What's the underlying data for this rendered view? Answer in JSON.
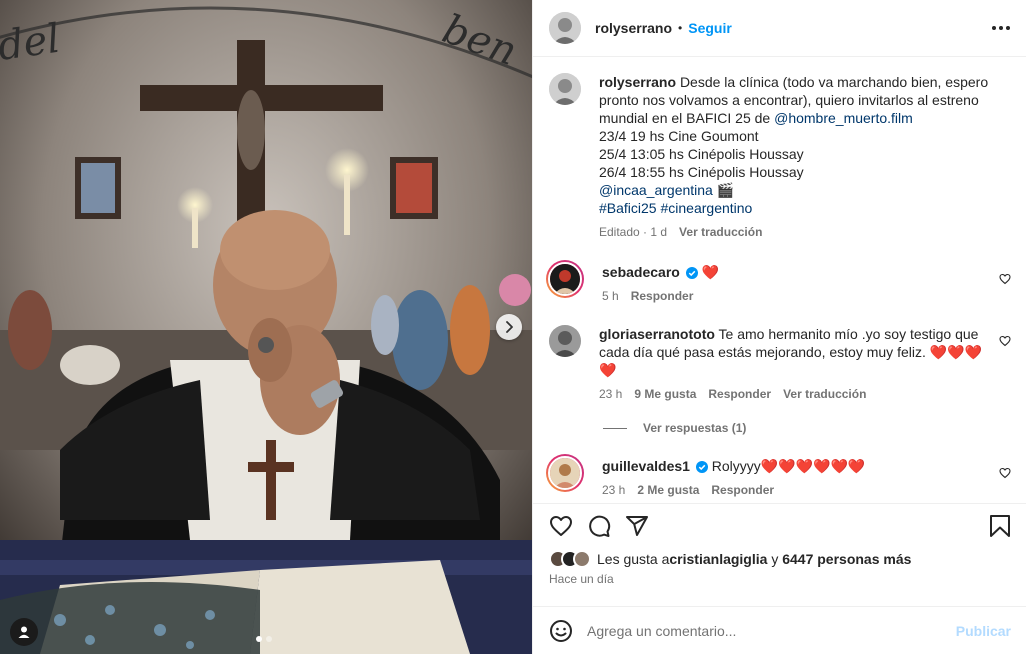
{
  "post": {
    "username": "rolyserrano",
    "follow_label": "Seguir",
    "separator": "•"
  },
  "caption": {
    "username": "rolyserrano",
    "line1": "Desde la clínica (todo va marchando bien, espero pronto nos volvamos a encontrar), quiero invitarlos al estreno mundial en el BAFICI 25 de ",
    "mention1": "@hombre_muerto.film",
    "line2": "23/4 19 hs Cine Goumont",
    "line3": "25/4 13:05 hs Cinépolis Houssay",
    "line4": "26/4 18:55 hs Cinépolis Houssay",
    "mention2": "@incaa_argentina",
    "emoji_clapper": "🎬",
    "hashtag1": "#Bafici25",
    "hashtag2": "#cineargentino",
    "meta_edited": "Editado · 1 d",
    "meta_translate": "Ver traducción"
  },
  "comments": [
    {
      "username": "sebadecaro",
      "text": "❤️",
      "time": "5 h",
      "reply": "Responder"
    },
    {
      "username": "gloriaserranototo",
      "text": "Te amo hermanito mío .yo soy testigo que cada día qué pasa estás mejorando, estoy muy feliz. ❤️❤️❤️❤️",
      "time": "23 h",
      "likes": "9 Me gusta",
      "reply": "Responder",
      "translate": "Ver traducción",
      "view_replies": "Ver respuestas (1)"
    },
    {
      "username": "guillevaldes1",
      "text": "Rolyyyy❤️❤️❤️❤️❤️❤️",
      "time": "23 h",
      "likes": "2 Me gusta",
      "reply": "Responder"
    }
  ],
  "likes": {
    "prefix": "Les gusta a ",
    "user": "cristianlagiglia",
    "middle": " y ",
    "count": "6447 personas más"
  },
  "time_ago": "Hace un día",
  "composer": {
    "placeholder": "Agrega un comentario...",
    "publish_label": "Publicar"
  },
  "carousel": {
    "total": 2,
    "active": 1
  },
  "colors": {
    "accent": "#0095f6",
    "link": "#00376b",
    "muted": "#737373",
    "heart": "#ed4956"
  },
  "icons": [
    "more-icon",
    "heart-icon",
    "comment-icon",
    "share-icon",
    "save-icon",
    "emoji-icon",
    "chevron-right-icon",
    "user-tag-icon",
    "verified-icon"
  ]
}
